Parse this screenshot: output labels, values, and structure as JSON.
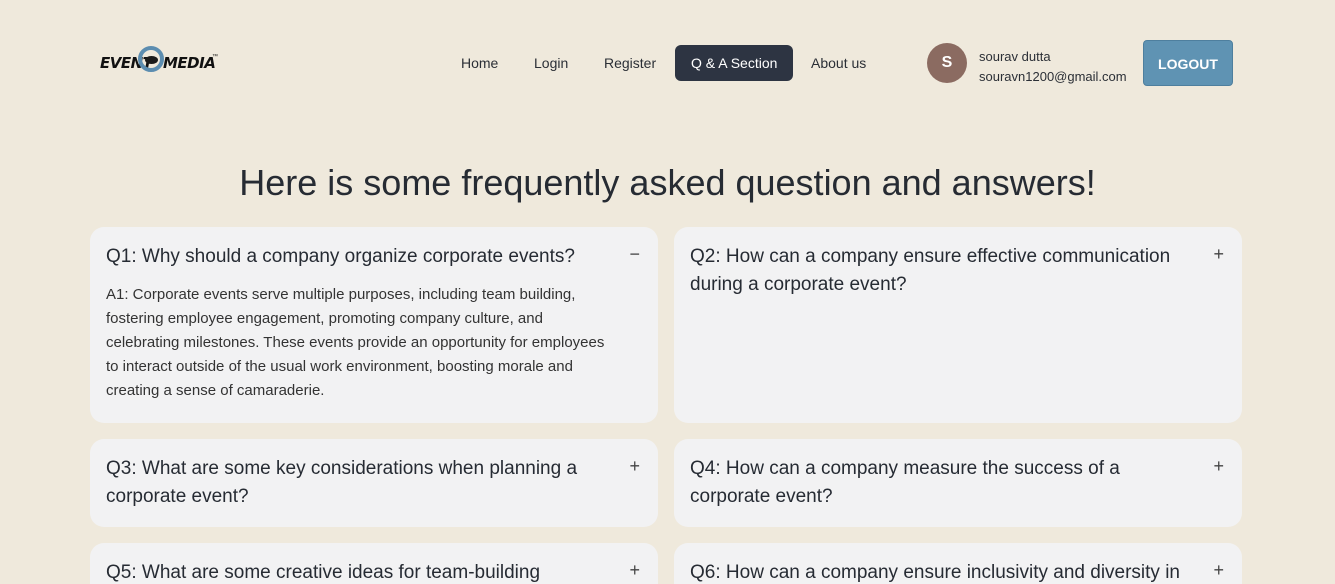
{
  "brand": {
    "logo_left": "EVENT",
    "logo_right": "MEDIA",
    "tm": "™"
  },
  "nav": [
    {
      "label": "Home",
      "active": false
    },
    {
      "label": "Login",
      "active": false
    },
    {
      "label": "Register",
      "active": false
    },
    {
      "label": "Q & A Section",
      "active": true
    },
    {
      "label": "About us",
      "active": false
    }
  ],
  "user": {
    "initial": "S",
    "name": "sourav dutta",
    "email": "souravn1200@gmail.com",
    "logout_label": "LOGOUT"
  },
  "heading": "Here is some frequently asked question and answers!",
  "faqs": [
    {
      "question": "Q1: Why should a company organize corporate events?",
      "toggle": "−",
      "answer": "A1: Corporate events serve multiple purposes, including team building, fostering employee engagement, promoting company culture, and celebrating milestones. These events provide an opportunity for employees to interact outside of the usual work environment, boosting morale and creating a sense of camaraderie."
    },
    {
      "question": "Q2: How can a company ensure effective communication during a corporate event?",
      "toggle": "+"
    },
    {
      "question": "Q3: What are some key considerations when planning a corporate event?",
      "toggle": "+"
    },
    {
      "question": "Q4: How can a company measure the success of a corporate event?",
      "toggle": "+"
    },
    {
      "question": "Q5: What are some creative ideas for team-building",
      "toggle": "+"
    },
    {
      "question": "Q6: How can a company ensure inclusivity and diversity in",
      "toggle": "+"
    }
  ],
  "colors": {
    "background": "#efe9dc",
    "nav_active": "#2d3442",
    "logout": "#5f93b3",
    "card": "#f2f2f3",
    "avatar": "#8b6b61"
  }
}
